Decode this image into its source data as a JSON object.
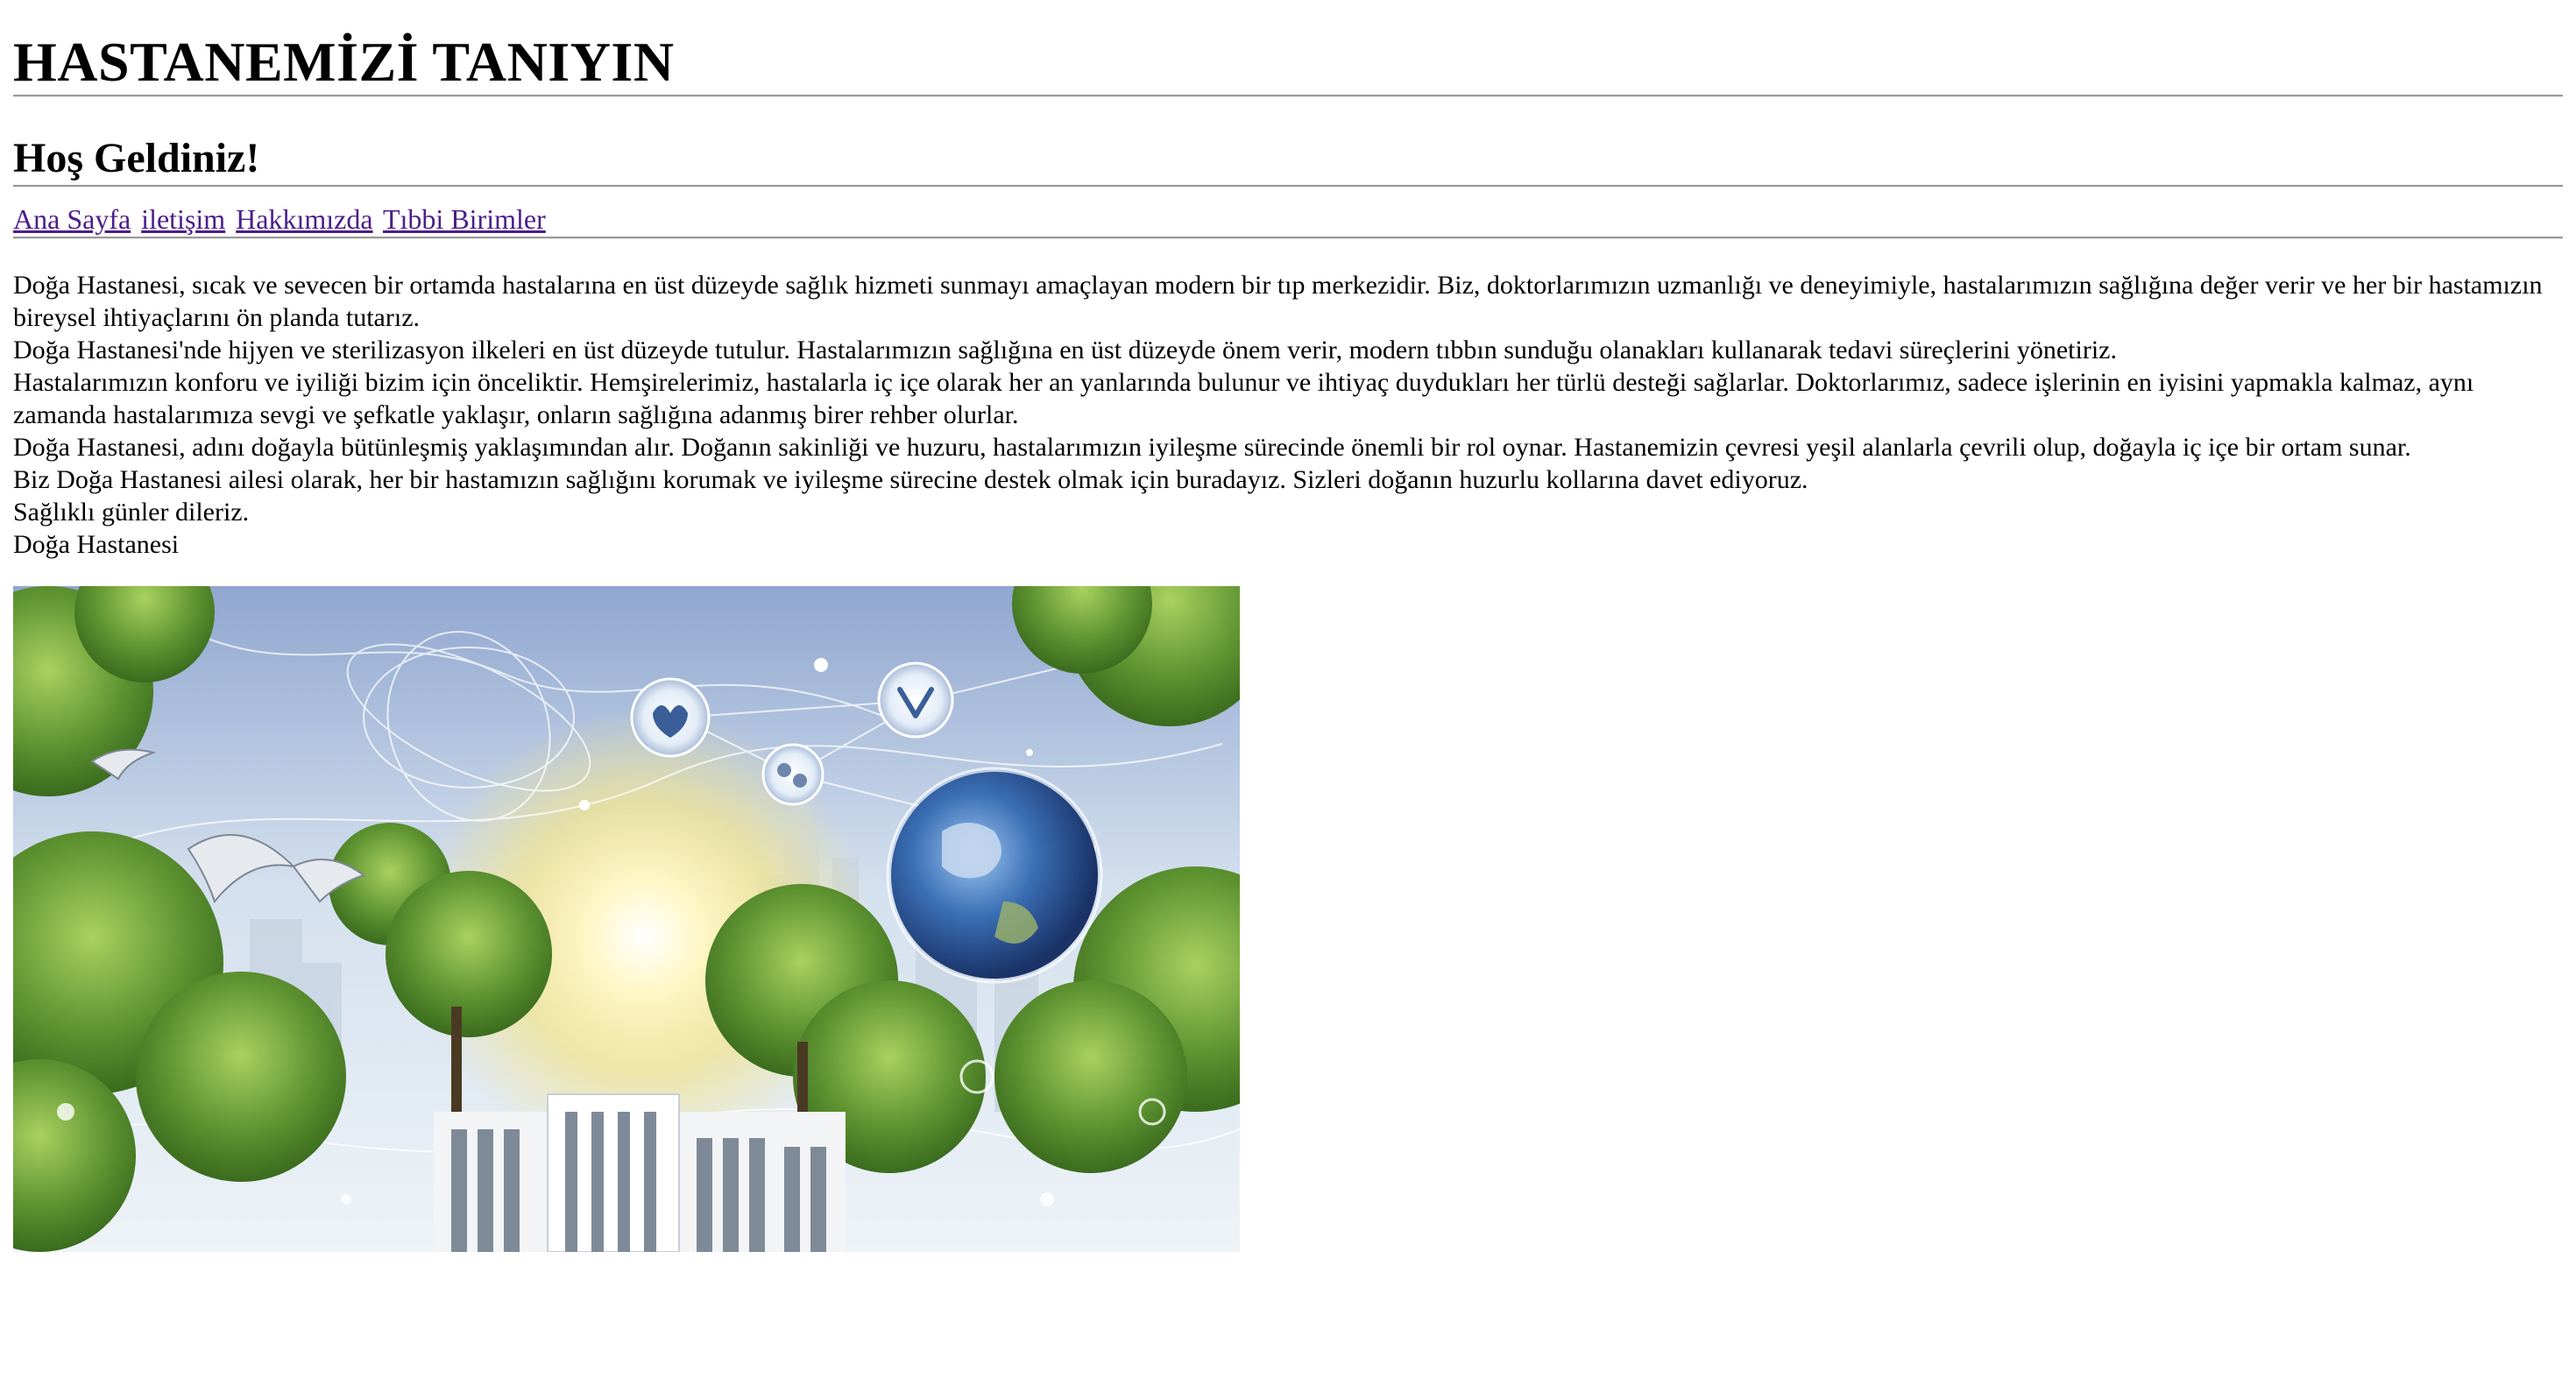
{
  "header": {
    "title": "HASTANEMİZİ TANIYIN",
    "welcome": "Hoş Geldiniz!"
  },
  "nav": {
    "items": [
      {
        "label": "Ana Sayfa"
      },
      {
        "label": "iletişim"
      },
      {
        "label": "Hakkımızda"
      },
      {
        "label": "Tıbbi Birimler"
      }
    ],
    "link_color": "#4c1d8c"
  },
  "content": {
    "paragraphs": [
      "Doğa Hastanesi, sıcak ve sevecen bir ortamda hastalarına en üst düzeyde sağlık hizmeti sunmayı amaçlayan modern bir tıp merkezidir. Biz, doktorlarımızın uzmanlığı ve deneyimiyle, hastalarımızın sağlığına değer verir ve her bir hastamızın bireysel ihtiyaçlarını ön planda tutarız.",
      "Doğa Hastanesi'nde hijyen ve sterilizasyon ilkeleri en üst düzeyde tutulur. Hastalarımızın sağlığına en üst düzeyde önem verir, modern tıbbın sunduğu olanakları kullanarak tedavi süreçlerini yönetiriz.",
      "Hastalarımızın konforu ve iyiliği bizim için önceliktir. Hemşirelerimiz, hastalarla iç içe olarak her an yanlarında bulunur ve ihtiyaç duydukları her türlü desteği sağlarlar. Doktorlarımız, sadece işlerinin en iyisini yapmakla kalmaz, aynı zamanda hastalarımıza sevgi ve şefkatle yaklaşır, onların sağlığına adanmış birer rehber olurlar.",
      "Doğa Hastanesi, adını doğayla bütünleşmiş yaklaşımından alır. Doğanın sakinliği ve huzuru, hastalarımızın iyileşme sürecinde önemli bir rol oynar. Hastanemizin çevresi yeşil alanlarla çevrili olup, doğayla iç içe bir ortam sunar.",
      "Biz Doğa Hastanesi ailesi olarak, her bir hastamızın sağlığını korumak ve iyileşme sürecine destek olmak için buradayız. Sizleri doğanın huzurlu kollarına davet ediyoruz.",
      "Sağlıklı günler dileriz.",
      "Doğa Hastanesi"
    ]
  },
  "hero_image": {
    "sky_color": "#b9cde6",
    "foliage_color": "#5c8e2e",
    "sun_color": "#fff6c2"
  }
}
